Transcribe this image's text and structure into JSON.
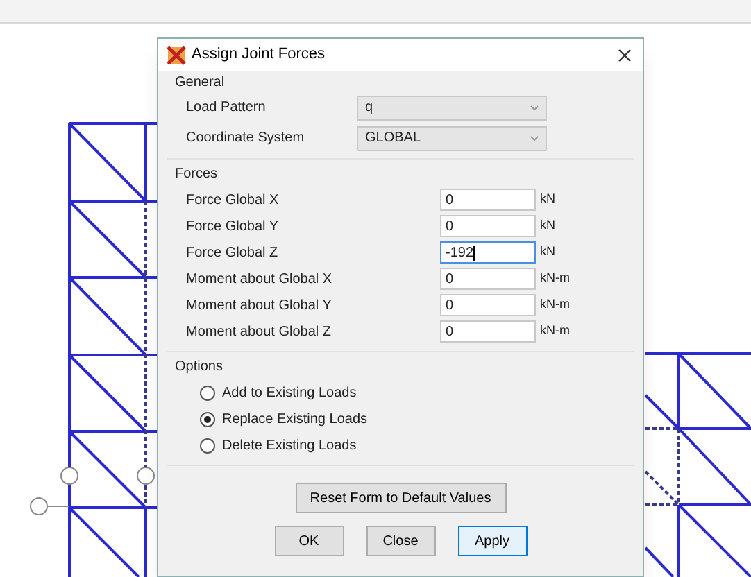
{
  "dialog": {
    "title": "Assign Joint Forces"
  },
  "general": {
    "header": "General",
    "fields": [
      {
        "label": "Load Pattern",
        "value": "q"
      },
      {
        "label": "Coordinate System",
        "value": "GLOBAL"
      }
    ]
  },
  "forces": {
    "header": "Forces",
    "rows": [
      {
        "label": "Force Global X",
        "value": "0",
        "unit": "kN",
        "focused": false
      },
      {
        "label": "Force Global Y",
        "value": "0",
        "unit": "kN",
        "focused": false
      },
      {
        "label": "Force Global Z",
        "value": "-192",
        "unit": "kN",
        "focused": true
      },
      {
        "label": "Moment about Global X",
        "value": "0",
        "unit": "kN-m",
        "focused": false
      },
      {
        "label": "Moment about Global Y",
        "value": "0",
        "unit": "kN-m",
        "focused": false
      },
      {
        "label": "Moment about Global Z",
        "value": "0",
        "unit": "kN-m",
        "focused": false
      }
    ]
  },
  "options": {
    "header": "Options",
    "radios": [
      {
        "label": "Add to Existing Loads",
        "selected": false
      },
      {
        "label": "Replace Existing Loads",
        "selected": true
      },
      {
        "label": "Delete Existing Loads",
        "selected": false
      }
    ]
  },
  "reset_button": "Reset Form to Default Values",
  "buttons": [
    {
      "label": "OK",
      "default": false
    },
    {
      "label": "Close",
      "default": false
    },
    {
      "label": "Apply",
      "default": true
    }
  ]
}
